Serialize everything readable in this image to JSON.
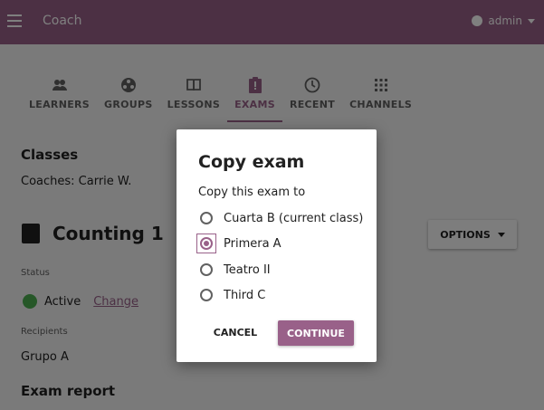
{
  "appbar": {
    "title": "Coach",
    "user": "admin"
  },
  "tabs": [
    {
      "label": "LEARNERS",
      "icon": "people-icon"
    },
    {
      "label": "GROUPS",
      "icon": "groups-icon"
    },
    {
      "label": "LESSONS",
      "icon": "book-icon"
    },
    {
      "label": "EXAMS",
      "icon": "clipboard-icon",
      "active": true
    },
    {
      "label": "RECENT",
      "icon": "clock-icon"
    },
    {
      "label": "CHANNELS",
      "icon": "grid-icon"
    }
  ],
  "page": {
    "section_title": "Classes",
    "coaches": "Coaches: Carrie W.",
    "exam_title": "Counting 1",
    "options_label": "OPTIONS",
    "status_label": "Status",
    "status_value": "Active",
    "status_change": "Change",
    "recipients_label": "Recipients",
    "recipients_value": "Grupo A",
    "report_title": "Exam report"
  },
  "dialog": {
    "title": "Copy exam",
    "subtitle": "Copy this exam to",
    "options": [
      {
        "label": "Cuarta B (current class)",
        "checked": false
      },
      {
        "label": "Primera A",
        "checked": true
      },
      {
        "label": "Teatro II",
        "checked": false
      },
      {
        "label": "Third C",
        "checked": false
      }
    ],
    "cancel_label": "CANCEL",
    "continue_label": "CONTINUE"
  },
  "colors": {
    "brand": "#996189",
    "active_status": "#4caf50"
  }
}
